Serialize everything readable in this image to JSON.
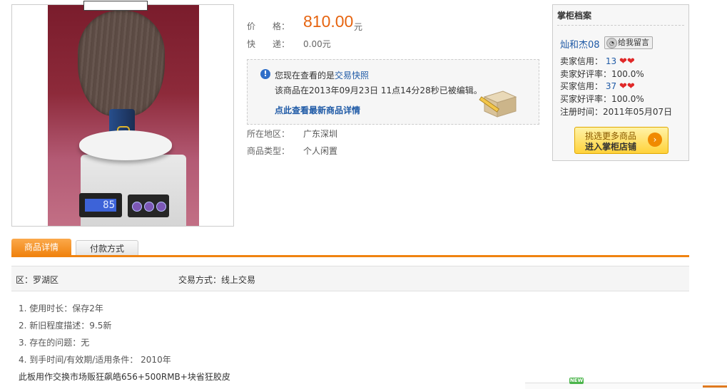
{
  "product": {
    "scale_reading": "85"
  },
  "price": {
    "label": "价　　格：",
    "value": "810.00",
    "unit": "元"
  },
  "shipping": {
    "label": "快　　递：",
    "value": "0.00元"
  },
  "snapshot": {
    "notice_prefix": "您现在查看的是",
    "notice_link": "交易快照",
    "edited_text": "该商品在2013年09月23日 11点14分28秒已被编辑。",
    "latest_link": "点此查看最新商品详情"
  },
  "details": {
    "region_label": "所在地区：",
    "region_value": "广东深圳",
    "type_label": "商品类型：",
    "type_value": "个人闲置"
  },
  "shopkeeper": {
    "title": "掌柜档案",
    "seller_name": "灿和杰08",
    "message_button": "给我留言",
    "seller_credit_label": "卖家信用：",
    "seller_credit_value": "13",
    "seller_rating_label": "卖家好评率：",
    "seller_rating_value": "100.0%",
    "buyer_credit_label": "买家信用：",
    "buyer_credit_value": "37",
    "buyer_rating_label": "买家好评率：",
    "buyer_rating_value": "100.0%",
    "register_label": "注册时间：",
    "register_value": "2011年05月07日",
    "shop_button_line1": "挑选更多商品",
    "shop_button_line2": "进入掌柜店铺"
  },
  "tabs": [
    {
      "label": "商品详情",
      "active": true
    },
    {
      "label": "付款方式",
      "active": false
    }
  ],
  "attributes": {
    "district": "区：罗湖区",
    "trade_method": "交易方式：线上交易"
  },
  "description": [
    "1. 使用时长：保存2年",
    "2. 新旧程度描述：9.5新",
    "3. 存在的问题：无",
    "4. 到手时间/有效期/适用条件：  2010年",
    "此板用作交换市场贩狂飙皓656+500RMB+块省狂胶皮"
  ],
  "footer": {
    "new_badge": "NEW"
  },
  "colors": {
    "accent_orange": "#f08310",
    "price_orange": "#e66410",
    "link_blue": "#1f5aa6"
  }
}
